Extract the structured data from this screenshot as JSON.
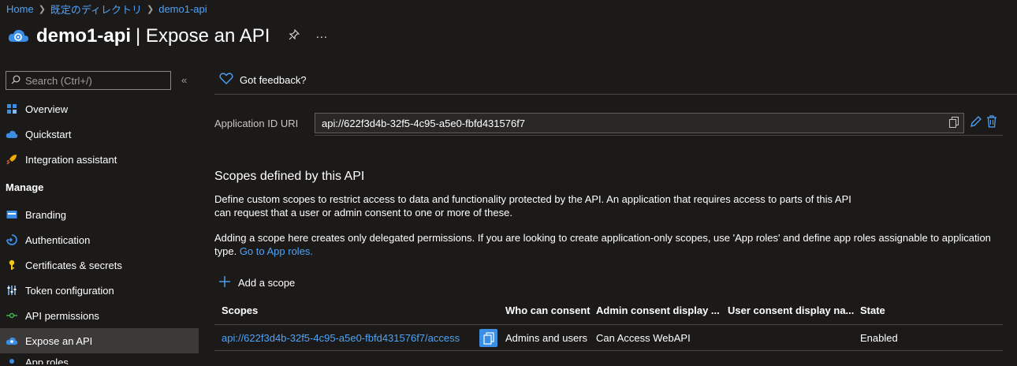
{
  "breadcrumb": [
    {
      "label": "Home"
    },
    {
      "label": "既定のディレクトリ"
    },
    {
      "label": "demo1-api"
    }
  ],
  "header": {
    "app_name": "demo1-api",
    "page_title": "| Expose an API",
    "more": "···"
  },
  "sidebar": {
    "search_placeholder": "Search (Ctrl+/)",
    "collapse": "«",
    "items": [
      {
        "label": "Overview",
        "icon": "overview-icon"
      },
      {
        "label": "Quickstart",
        "icon": "quickstart-icon"
      },
      {
        "label": "Integration assistant",
        "icon": "rocket-icon"
      }
    ],
    "section": "Manage",
    "manage_items": [
      {
        "label": "Branding",
        "icon": "branding-icon"
      },
      {
        "label": "Authentication",
        "icon": "authentication-icon"
      },
      {
        "label": "Certificates & secrets",
        "icon": "key-icon"
      },
      {
        "label": "Token configuration",
        "icon": "token-config-icon"
      },
      {
        "label": "API permissions",
        "icon": "api-permissions-icon"
      },
      {
        "label": "Expose an API",
        "icon": "expose-api-icon",
        "active": true
      },
      {
        "label": "App roles",
        "icon": "app-roles-icon"
      }
    ]
  },
  "main": {
    "feedback": "Got feedback?",
    "appid_label": "Application ID URI",
    "appid_value": "api://622f3d4b-32f5-4c95-a5e0-fbfd431576f7",
    "scopes_title": "Scopes defined by this API",
    "desc1": "Define custom scopes to restrict access to data and functionality protected by the API. An application that requires access to parts of this API can request that a user or admin consent to one or more of these.",
    "desc2": "Adding a scope here creates only delegated permissions. If you are looking to create application-only scopes, use 'App roles' and define app roles assignable to application type.",
    "desc2_link": "Go to App roles.",
    "add_scope": "Add a scope",
    "table": {
      "headers": [
        "Scopes",
        "Who can consent",
        "Admin consent display ...",
        "User consent display na...",
        "State"
      ],
      "rows": [
        {
          "scope": "api://622f3d4b-32f5-4c95-a5e0-fbfd431576f7/access",
          "who": "Admins and users",
          "admin_display": "Can Access WebAPI",
          "user_display": "",
          "state": "Enabled"
        }
      ]
    }
  },
  "colors": {
    "background": "#1b1a19",
    "link": "#4fa3f7",
    "accent": "#3a8ee6"
  }
}
